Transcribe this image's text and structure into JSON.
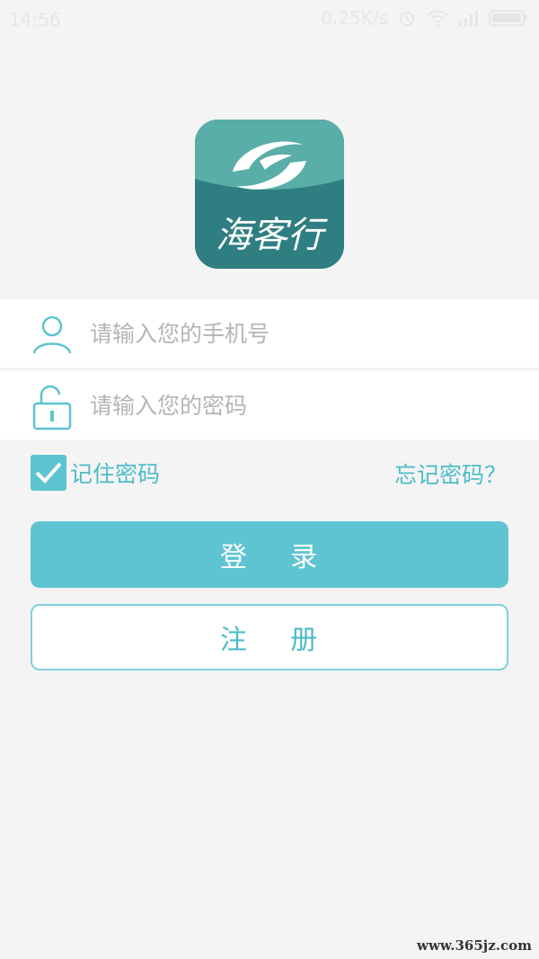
{
  "status_bar": {
    "time": "14:56",
    "network_speed": "0.25K/s",
    "icons": [
      "alarm-icon",
      "wifi-icon",
      "signal-icon",
      "battery-icon"
    ]
  },
  "logo": {
    "text": "海客行",
    "colors": {
      "top": "#5aaea8",
      "bottom": "#2f7e82"
    }
  },
  "login_form": {
    "phone_placeholder": "请输入您的手机号",
    "phone_value": "",
    "password_placeholder": "请输入您的密码",
    "password_value": "",
    "remember_label": "记住密码",
    "remember_checked": true,
    "forgot_label": "忘记密码？",
    "login_button": "登    录",
    "register_button": "注    册"
  },
  "watermark": "www.365jz.com",
  "colors": {
    "accent": "#5fc4d2",
    "accent_text": "#4dbcc9",
    "background": "#f4f4f4"
  }
}
